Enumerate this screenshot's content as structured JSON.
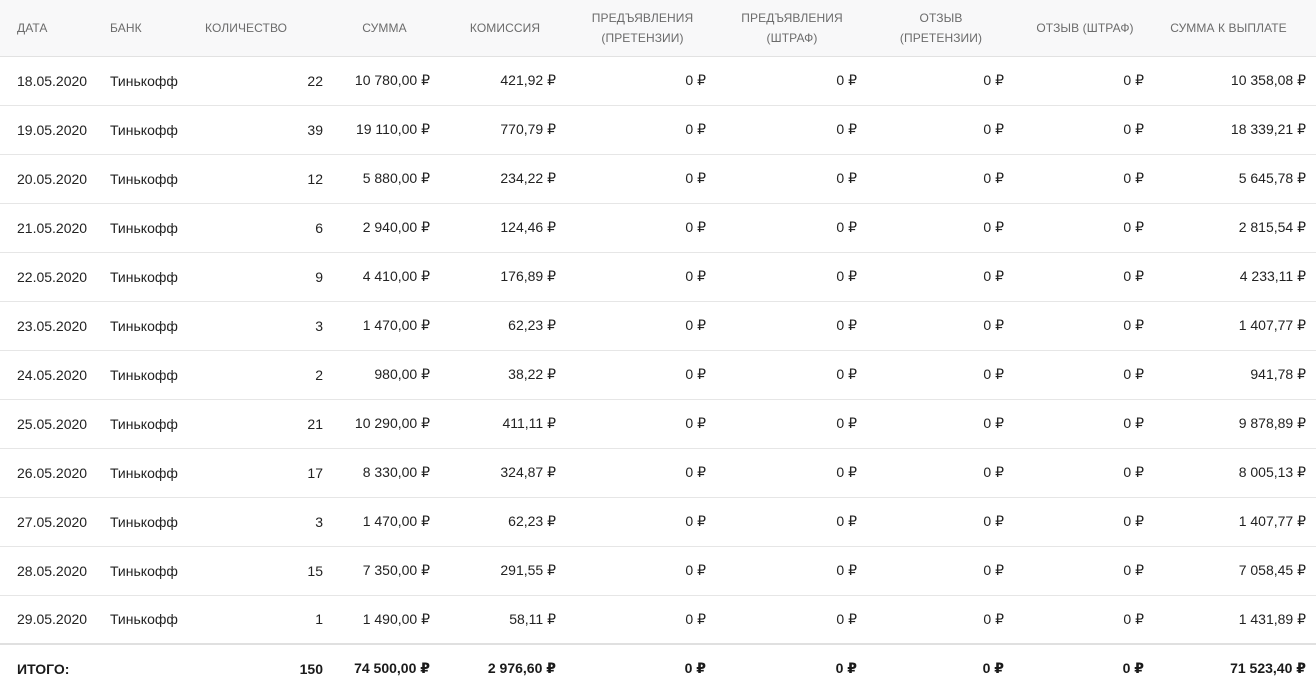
{
  "table": {
    "headers": {
      "date": "ДАТА",
      "bank": "БАНК",
      "quantity": "КОЛИЧЕСТВО",
      "sum": "СУММА",
      "commission": "КОМИССИЯ",
      "presentments_claims_line1": "ПРЕДЪЯВЛЕНИЯ",
      "presentments_claims_line2": "(ПРЕТЕНЗИИ)",
      "presentments_penalty_line1": "ПРЕДЪЯВЛЕНИЯ",
      "presentments_penalty_line2": "(ШТРАФ)",
      "recall_claims_line1": "ОТЗЫВ",
      "recall_claims_line2": "(ПРЕТЕНЗИИ)",
      "recall_penalty": "ОТЗЫВ (ШТРАФ)",
      "payout": "СУММА К ВЫПЛАТЕ"
    },
    "rows": [
      {
        "date": "18.05.2020",
        "bank": "Тинькофф",
        "quantity": "22",
        "sum": "10 780,00 ₽",
        "commission": "421,92 ₽",
        "presentments_claims": "0 ₽",
        "presentments_penalty": "0 ₽",
        "recall_claims": "0 ₽",
        "recall_penalty": "0 ₽",
        "payout": "10 358,08 ₽"
      },
      {
        "date": "19.05.2020",
        "bank": "Тинькофф",
        "quantity": "39",
        "sum": "19 110,00 ₽",
        "commission": "770,79 ₽",
        "presentments_claims": "0 ₽",
        "presentments_penalty": "0 ₽",
        "recall_claims": "0 ₽",
        "recall_penalty": "0 ₽",
        "payout": "18 339,21 ₽"
      },
      {
        "date": "20.05.2020",
        "bank": "Тинькофф",
        "quantity": "12",
        "sum": "5 880,00 ₽",
        "commission": "234,22 ₽",
        "presentments_claims": "0 ₽",
        "presentments_penalty": "0 ₽",
        "recall_claims": "0 ₽",
        "recall_penalty": "0 ₽",
        "payout": "5 645,78 ₽"
      },
      {
        "date": "21.05.2020",
        "bank": "Тинькофф",
        "quantity": "6",
        "sum": "2 940,00 ₽",
        "commission": "124,46 ₽",
        "presentments_claims": "0 ₽",
        "presentments_penalty": "0 ₽",
        "recall_claims": "0 ₽",
        "recall_penalty": "0 ₽",
        "payout": "2 815,54 ₽"
      },
      {
        "date": "22.05.2020",
        "bank": "Тинькофф",
        "quantity": "9",
        "sum": "4 410,00 ₽",
        "commission": "176,89 ₽",
        "presentments_claims": "0 ₽",
        "presentments_penalty": "0 ₽",
        "recall_claims": "0 ₽",
        "recall_penalty": "0 ₽",
        "payout": "4 233,11 ₽"
      },
      {
        "date": "23.05.2020",
        "bank": "Тинькофф",
        "quantity": "3",
        "sum": "1 470,00 ₽",
        "commission": "62,23 ₽",
        "presentments_claims": "0 ₽",
        "presentments_penalty": "0 ₽",
        "recall_claims": "0 ₽",
        "recall_penalty": "0 ₽",
        "payout": "1 407,77 ₽"
      },
      {
        "date": "24.05.2020",
        "bank": "Тинькофф",
        "quantity": "2",
        "sum": "980,00 ₽",
        "commission": "38,22 ₽",
        "presentments_claims": "0 ₽",
        "presentments_penalty": "0 ₽",
        "recall_claims": "0 ₽",
        "recall_penalty": "0 ₽",
        "payout": "941,78 ₽"
      },
      {
        "date": "25.05.2020",
        "bank": "Тинькофф",
        "quantity": "21",
        "sum": "10 290,00 ₽",
        "commission": "411,11 ₽",
        "presentments_claims": "0 ₽",
        "presentments_penalty": "0 ₽",
        "recall_claims": "0 ₽",
        "recall_penalty": "0 ₽",
        "payout": "9 878,89 ₽"
      },
      {
        "date": "26.05.2020",
        "bank": "Тинькофф",
        "quantity": "17",
        "sum": "8 330,00 ₽",
        "commission": "324,87 ₽",
        "presentments_claims": "0 ₽",
        "presentments_penalty": "0 ₽",
        "recall_claims": "0 ₽",
        "recall_penalty": "0 ₽",
        "payout": "8 005,13 ₽"
      },
      {
        "date": "27.05.2020",
        "bank": "Тинькофф",
        "quantity": "3",
        "sum": "1 470,00 ₽",
        "commission": "62,23 ₽",
        "presentments_claims": "0 ₽",
        "presentments_penalty": "0 ₽",
        "recall_claims": "0 ₽",
        "recall_penalty": "0 ₽",
        "payout": "1 407,77 ₽"
      },
      {
        "date": "28.05.2020",
        "bank": "Тинькофф",
        "quantity": "15",
        "sum": "7 350,00 ₽",
        "commission": "291,55 ₽",
        "presentments_claims": "0 ₽",
        "presentments_penalty": "0 ₽",
        "recall_claims": "0 ₽",
        "recall_penalty": "0 ₽",
        "payout": "7 058,45 ₽"
      },
      {
        "date": "29.05.2020",
        "bank": "Тинькофф",
        "quantity": "1",
        "sum": "1 490,00 ₽",
        "commission": "58,11 ₽",
        "presentments_claims": "0 ₽",
        "presentments_penalty": "0 ₽",
        "recall_claims": "0 ₽",
        "recall_penalty": "0 ₽",
        "payout": "1 431,89 ₽"
      }
    ],
    "totals": {
      "label": "ИТОГО:",
      "quantity": "150",
      "sum": "74 500,00 ₽",
      "commission": "2 976,60 ₽",
      "presentments_claims": "0 ₽",
      "presentments_penalty": "0 ₽",
      "recall_claims": "0 ₽",
      "recall_penalty": "0 ₽",
      "payout": "71 523,40 ₽"
    }
  }
}
